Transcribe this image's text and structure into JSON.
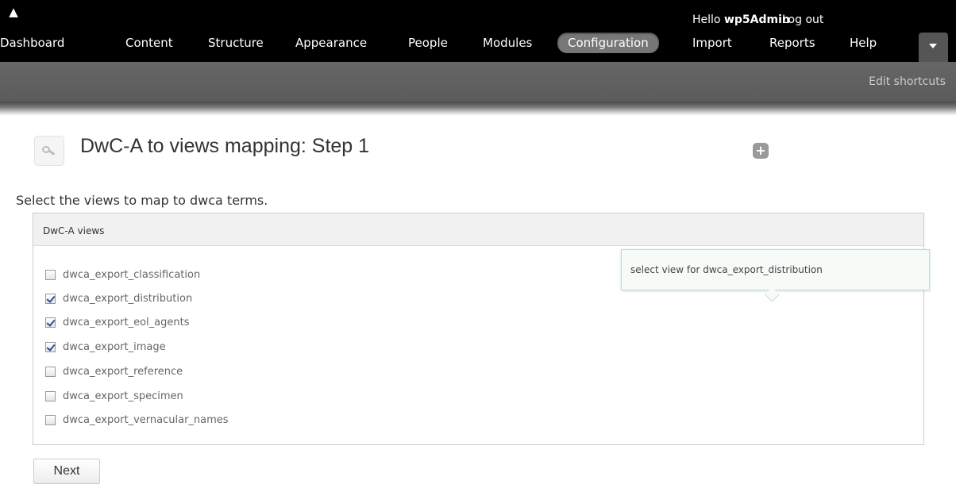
{
  "toolbar": {
    "hello_prefix": "Hello ",
    "username": "wp5Admin",
    "logout_label": "Log out",
    "menu": [
      {
        "label": "Dashboard"
      },
      {
        "label": "Content"
      },
      {
        "label": "Structure"
      },
      {
        "label": "Appearance"
      },
      {
        "label": "People"
      },
      {
        "label": "Modules"
      },
      {
        "label": "Configuration",
        "active": true
      },
      {
        "label": "Import"
      },
      {
        "label": "Reports"
      },
      {
        "label": "Help"
      }
    ]
  },
  "shortcuts": {
    "edit_label": "Edit shortcuts"
  },
  "page": {
    "title": "DwC-A to views mapping: Step 1",
    "intro": "Select the views to map to dwca terms."
  },
  "form": {
    "legend": "DwC-A views",
    "options": [
      {
        "label": "dwca_export_classification",
        "checked": false
      },
      {
        "label": "dwca_export_distribution",
        "checked": true
      },
      {
        "label": "dwca_export_eol_agents",
        "checked": true
      },
      {
        "label": "dwca_export_image",
        "checked": true
      },
      {
        "label": "dwca_export_reference",
        "checked": false
      },
      {
        "label": "dwca_export_specimen",
        "checked": false
      },
      {
        "label": "dwca_export_vernacular_names",
        "checked": false
      }
    ],
    "tooltip": "select view for dwca_export_distribution",
    "next_label": "Next"
  },
  "colors": {
    "toolbar_bg": "#000000",
    "active_menu_bg": "#777777",
    "shortcuts_bg": "#5f5f5f",
    "checkmark": "#2a4aa8"
  }
}
